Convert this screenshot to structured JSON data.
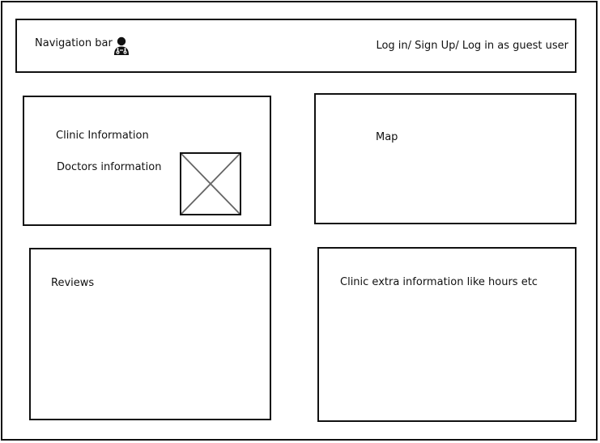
{
  "navbar": {
    "title": "Navigation bar",
    "icon": "doctor-user-icon",
    "auth_links": "Log in/ Sign Up/ Log in as guest user"
  },
  "clinic_panel": {
    "clinic_information": "Clinic Information",
    "doctors_information": "Doctors  information",
    "image_placeholder_icon": "image-placeholder-icon"
  },
  "map_panel": {
    "label": "Map"
  },
  "reviews_panel": {
    "label": "Reviews"
  },
  "extra_panel": {
    "label": "Clinic extra information like hours etc"
  }
}
